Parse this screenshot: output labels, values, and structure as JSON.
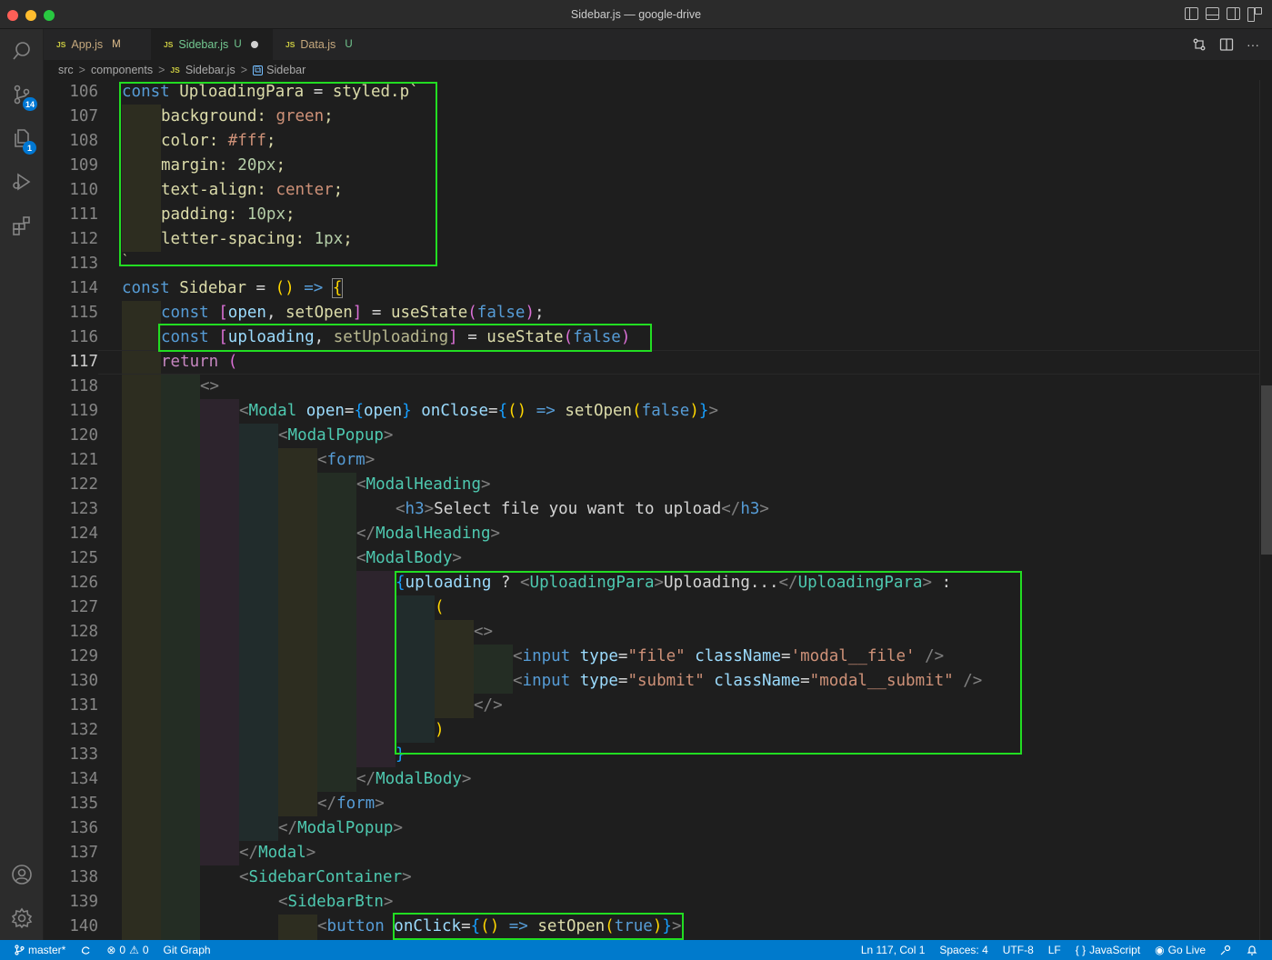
{
  "window": {
    "title": "Sidebar.js — google-drive"
  },
  "activity_bar": {
    "source_control_badge": "14",
    "extensions_badge": "1"
  },
  "tabs": [
    {
      "icon": "JS",
      "label": "App.js",
      "status": "M"
    },
    {
      "icon": "JS",
      "label": "Sidebar.js",
      "status": "U"
    },
    {
      "icon": "JS",
      "label": "Data.js",
      "status": "U"
    }
  ],
  "editor_actions": {
    "more": "···"
  },
  "breadcrumb": {
    "items": [
      "src",
      "components",
      "Sidebar.js",
      "Sidebar"
    ],
    "file_icon": "JS",
    "sep": ">"
  },
  "editor": {
    "current_line": "117",
    "line_numbers": [
      "106",
      "107",
      "108",
      "109",
      "110",
      "111",
      "112",
      "113",
      "114",
      "115",
      "116",
      "117",
      "118",
      "119",
      "120",
      "121",
      "122",
      "123",
      "124",
      "125",
      "126",
      "127",
      "128",
      "129",
      "130",
      "131",
      "132",
      "133",
      "134",
      "135",
      "136",
      "137",
      "138",
      "139",
      "140"
    ],
    "code": {
      "l106": {
        "kw": "const",
        "name": "UploadingPara",
        "eq": " = ",
        "fn": "styled",
        "rest": ".p`"
      },
      "l107": {
        "prop": "background",
        "colon": ": ",
        "val": "green",
        "semi": ";"
      },
      "l108": {
        "prop": "color",
        "colon": ": ",
        "val": "#fff",
        "semi": ";"
      },
      "l109": {
        "prop": "margin",
        "colon": ": ",
        "val": "20px",
        "semi": ";"
      },
      "l110": {
        "prop": "text-align",
        "colon": ": ",
        "val": "center",
        "semi": ";"
      },
      "l111": {
        "prop": "padding",
        "colon": ": ",
        "val": "10px",
        "semi": ";"
      },
      "l112": {
        "prop": "letter-spacing",
        "colon": ": ",
        "val": "1px",
        "semi": ";"
      },
      "l113": {
        "text": "`"
      },
      "l114": {
        "kw": "const",
        "name": "Sidebar",
        "eq": " = ",
        "paren": "()",
        "arrow": " => ",
        "brace": "{"
      },
      "l115": {
        "kw": "const",
        "open_br": "[",
        "a": "open",
        "comma": ", ",
        "b": "setOpen",
        "close_br": "]",
        "eq": " = ",
        "fn": "useState",
        "lp": "(",
        "val": "false",
        "rp": ")",
        "semi": ";"
      },
      "l116": {
        "kw": "const",
        "open_br": "[",
        "a": "uploading",
        "comma": ", ",
        "b": "setUploading",
        "close_br": "]",
        "eq": " = ",
        "fn": "useState",
        "lp": "(",
        "val": "false",
        "rp": ")"
      },
      "l117": {
        "kw": "return",
        "paren": " ("
      },
      "l118": {
        "text": "<>"
      },
      "l119": {
        "lt": "<",
        "tag": "Modal",
        "a1": " open",
        "eq1": "=",
        "lb1": "{",
        "v1": "open",
        "rb1": "}",
        "a2": " onClose",
        "eq2": "=",
        "lb2": "{",
        "p": "()",
        "arrow": " => ",
        "fn": "setOpen",
        "lp": "(",
        "v2": "false",
        "rp": ")",
        "rb2": "}",
        "gt": ">"
      },
      "l120": {
        "lt": "<",
        "tag": "ModalPopup",
        "gt": ">"
      },
      "l121": {
        "lt": "<",
        "tag": "form",
        "gt": ">"
      },
      "l122": {
        "lt": "<",
        "tag": "ModalHeading",
        "gt": ">"
      },
      "l123": {
        "lt": "<",
        "tag": "h3",
        "gt": ">",
        "text": "Select file you want to upload",
        "close_lt": "</",
        "close_tag": "h3",
        "close_gt": ">"
      },
      "l124": {
        "lt": "</",
        "tag": "ModalHeading",
        "gt": ">"
      },
      "l125": {
        "lt": "<",
        "tag": "ModalBody",
        "gt": ">"
      },
      "l126": {
        "lb": "{",
        "v": "uploading",
        "q": " ? ",
        "lt": "<",
        "tag": "UploadingPara",
        "gt": ">",
        "text": "Uploading...",
        "close_lt": "</",
        "close_tag": "UploadingPara",
        "close_gt": ">",
        "colon": " :"
      },
      "l127": {
        "text": "("
      },
      "l128": {
        "text": "<>"
      },
      "l129": {
        "lt": "<",
        "tag": "input",
        "a1": " type",
        "eq1": "=",
        "s1": "\"file\"",
        "a2": " className",
        "eq2": "=",
        "s2": "'modal__file'",
        "end": " />"
      },
      "l130": {
        "lt": "<",
        "tag": "input",
        "a1": " type",
        "eq1": "=",
        "s1": "\"submit\"",
        "a2": " className",
        "eq2": "=",
        "s2": "\"modal__submit\"",
        "end": " />"
      },
      "l131": {
        "text": "</>"
      },
      "l132": {
        "text": ")"
      },
      "l133": {
        "text": "}"
      },
      "l134": {
        "lt": "</",
        "tag": "ModalBody",
        "gt": ">"
      },
      "l135": {
        "lt": "</",
        "tag": "form",
        "gt": ">"
      },
      "l136": {
        "lt": "</",
        "tag": "ModalPopup",
        "gt": ">"
      },
      "l137": {
        "lt": "</",
        "tag": "Modal",
        "gt": ">"
      },
      "l138": {
        "lt": "<",
        "tag": "SidebarContainer",
        "gt": ">"
      },
      "l139": {
        "lt": "<",
        "tag": "SidebarBtn",
        "gt": ">"
      },
      "l140": {
        "lt": "<",
        "tag": "button",
        "a1": " onClick",
        "eq1": "=",
        "lb": "{",
        "p": "()",
        "arrow": " => ",
        "fn": "setOpen",
        "lp": "(",
        "v": "true",
        "rp": ")",
        "rb": "}",
        "gt": ">"
      }
    }
  },
  "statusbar": {
    "branch": "master*",
    "errors": "0",
    "warnings": "0",
    "git_graph": "Git Graph",
    "position": "Ln 117, Col 1",
    "spaces": "Spaces: 4",
    "encoding": "UTF-8",
    "eol": "LF",
    "language": "JavaScript",
    "go_live": "Go Live"
  },
  "colors": {
    "accent": "#007acc",
    "highlight_box": "#22dd22"
  }
}
